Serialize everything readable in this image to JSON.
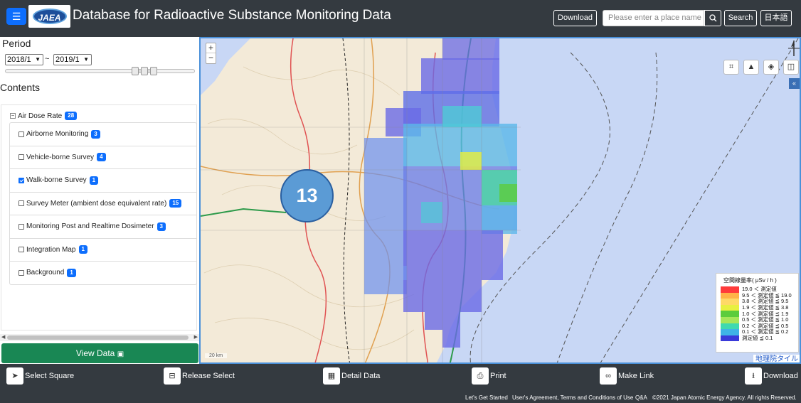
{
  "header": {
    "app_title": "Database for Radioactive Substance Monitoring Data",
    "logo_text": "JAEA",
    "download_label": "Download",
    "search_placeholder": "Please enter a place name o",
    "search_label": "Search",
    "language_label": "日本語"
  },
  "sidebar": {
    "period_title": "Period",
    "period_from": "2018/1",
    "period_to": "2019/1",
    "period_sep": "~",
    "contents_title": "Contents",
    "root": {
      "label": "Air Dose Rate",
      "count": "28"
    },
    "items": [
      {
        "label": "Airborne Monitoring",
        "count": "3",
        "checked": false
      },
      {
        "label": "Vehicle-borne Survey",
        "count": "4",
        "checked": false
      },
      {
        "label": "Walk-borne Survey",
        "count": "1",
        "checked": true
      },
      {
        "label": "Survey Meter (ambient dose equivalent rate)",
        "count": "15",
        "checked": false
      },
      {
        "label": "Monitoring Post and Realtime Dosimeter",
        "count": "3",
        "checked": false
      },
      {
        "label": "Integration Map",
        "count": "1",
        "checked": false
      },
      {
        "label": "Background",
        "count": "1",
        "checked": false
      }
    ],
    "view_data_label": "View Data"
  },
  "map": {
    "cluster_count": "13",
    "zoom_in": "+",
    "zoom_out": "−",
    "scale_text": "20 km",
    "tile_credit": "地理院タイル",
    "legend": {
      "title": "空間線量率( μSv / h )",
      "rows": [
        {
          "color": "#ff3b3b",
          "text": "19.0 ＜ 測定値"
        },
        {
          "color": "#ffb347",
          "text": "9.5 ＜ 測定値 ≦ 19.0"
        },
        {
          "color": "#ffd966",
          "text": "3.8 ＜ 測定値 ≦ 9.5"
        },
        {
          "color": "#e8f040",
          "text": "1.9 ＜ 測定値 ≦ 3.8"
        },
        {
          "color": "#5ccc3d",
          "text": "1.0 ＜ 測定値 ≦ 1.9"
        },
        {
          "color": "#a6e65a",
          "text": "0.5 ＜ 測定値 ≦ 1.0"
        },
        {
          "color": "#3fd9b0",
          "text": "0.2 ＜ 測定値 ≦ 0.5"
        },
        {
          "color": "#3fb3e6",
          "text": "0.1 ＜ 測定値 ≦ 0.2"
        },
        {
          "color": "#3a3ad9",
          "text": "測定値 ≦ 0.1"
        }
      ]
    }
  },
  "bottom_bar": {
    "select_square": "Select Square",
    "release_select": "Release Select",
    "detail_data": "Detail Data",
    "print": "Print",
    "make_link": "Make Link",
    "download": "Download"
  },
  "footer": {
    "getting_started": "Let's Get Started",
    "terms": "User's Agreement, Terms and Conditions of Use",
    "qa": "Q&A",
    "copyright": "©2021 Japan Atomic Energy Agency. All rights Reserved."
  },
  "colors": {
    "accent": "#0d6efd",
    "view_data": "#198754",
    "bar": "#343a40",
    "map_border": "#4a90d9"
  }
}
